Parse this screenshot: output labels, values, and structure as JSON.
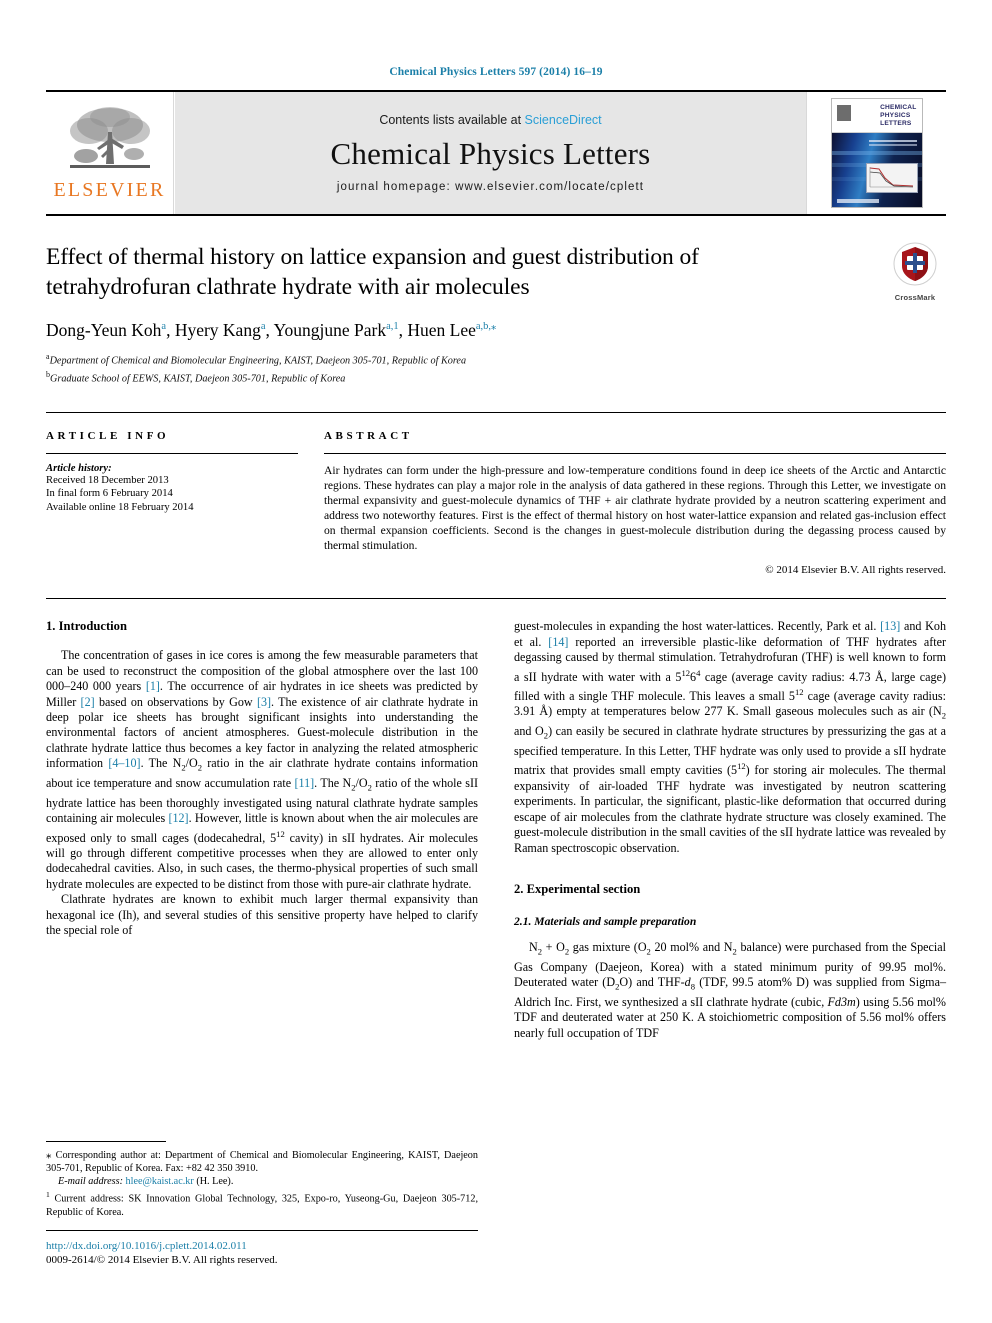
{
  "running_head": "Chemical Physics Letters 597 (2014) 16–19",
  "masthead": {
    "publisher_name": "ELSEVIER",
    "contents_prefix": "Contents lists available at ",
    "sciencedirect": "ScienceDirect",
    "journal_name": "Chemical Physics Letters",
    "homepage": "journal homepage: www.elsevier.com/locate/cplett",
    "cover_title_line1": "CHEMICAL",
    "cover_title_line2": "PHYSICS",
    "cover_title_line3": "LETTERS"
  },
  "article": {
    "title": "Effect of thermal history on lattice expansion and guest distribution of tetrahydrofuran clathrate hydrate with air molecules",
    "crossmark_label": "CrossMark",
    "authors": [
      {
        "name": "Dong-Yeun Koh",
        "marks": "a",
        "sep": ", "
      },
      {
        "name": "Hyery Kang",
        "marks": "a",
        "sep": ", "
      },
      {
        "name": "Youngjune Park",
        "marks": "a,1",
        "sep": ", "
      },
      {
        "name": "Huen Lee",
        "marks": "a,b,⁎",
        "sep": ""
      }
    ],
    "affiliations": [
      {
        "mark": "a",
        "text": "Department of Chemical and Biomolecular Engineering, KAIST, Daejeon 305-701, Republic of Korea"
      },
      {
        "mark": "b",
        "text": "Graduate School of EEWS, KAIST, Daejeon 305-701, Republic of Korea"
      }
    ]
  },
  "info": {
    "heading": "ARTICLE INFO",
    "history_label": "Article history:",
    "history": [
      "Received 18 December 2013",
      "In final form 6 February 2014",
      "Available online 18 February 2014"
    ]
  },
  "abstract": {
    "heading": "ABSTRACT",
    "text": "Air hydrates can form under the high-pressure and low-temperature conditions found in deep ice sheets of the Arctic and Antarctic regions. These hydrates can play a major role in the analysis of data gathered in these regions. Through this Letter, we investigate on thermal expansivity and guest-molecule dynamics of THF + air clathrate hydrate provided by a neutron scattering experiment and address two noteworthy features. First is the effect of thermal history on host water-lattice expansion and related gas-inclusion effect on thermal expansion coefficients. Second is the changes in guest-molecule distribution during the degassing process caused by thermal stimulation.",
    "copyright": "© 2014 Elsevier B.V. All rights reserved."
  },
  "sections": {
    "introduction_heading": "1. Introduction",
    "experimental_heading": "2. Experimental section",
    "materials_heading": "2.1. Materials and sample preparation"
  },
  "left_column": {
    "p1_a": "The concentration of gases in ice cores is among the few measurable parameters that can be used to reconstruct the composition of the global atmosphere over the last 100 000–240 000 years ",
    "p1_r1": "[1]",
    "p1_b": ". The occurrence of air hydrates in ice sheets was predicted by Miller ",
    "p1_r2": "[2]",
    "p1_c": " based on observations by Gow ",
    "p1_r3": "[3]",
    "p1_d": ". The existence of air clathrate hydrate in deep polar ice sheets has brought significant insights into understanding the environmental factors of ancient atmospheres. Guest-molecule distribution in the clathrate hydrate lattice thus becomes a key factor in analyzing the related atmospheric information ",
    "p1_r4": "[4–10]",
    "p1_e": ". The N",
    "p1_f": " ratio in the air clathrate hydrate contains information about ice temperature and snow accumulation rate ",
    "p1_r5": "[11]",
    "p1_g": ". The N",
    "p1_h": " ratio of the whole sII hydrate lattice has been thoroughly investigated using natural clathrate hydrate samples containing air molecules ",
    "p1_r6": "[12]",
    "p1_i": ". However, little is known about when the air molecules are exposed only to small cages (dodecahedral, 5",
    "p1_j": " cavity) in sII hydrates. Air molecules will go through different competitive processes when they are allowed to enter only dodecahedral cavities. Also, in such cases, the thermo-physical properties of such small hydrate molecules are expected to be distinct from those with pure-air clathrate hydrate.",
    "p2": "Clathrate hydrates are known to exhibit much larger thermal expansivity than hexagonal ice (Ih), and several studies of this sensitive property have helped to clarify the special role of"
  },
  "right_column": {
    "p1_a": "guest-molecules in expanding the host water-lattices. Recently, Park et al. ",
    "p1_r1": "[13]",
    "p1_b": " and Koh et al. ",
    "p1_r2": "[14]",
    "p1_c": " reported an irreversible plastic-like deformation of THF hydrates after degassing caused by thermal stimulation. Tetrahydrofuran (THF) is well known to form a sII hydrate with water with a 5",
    "p1_d": " cage (average cavity radius: 4.73 Å, large cage) filled with a single THF molecule. This leaves a small 5",
    "p1_e": " cage (average cavity radius: 3.91 Å) empty at temperatures below 277 K. Small gaseous molecules such as air (N",
    "p1_f": " and O",
    "p1_g": ") can easily be secured in clathrate hydrate structures by pressurizing the gas at a specified temperature. In this Letter, THF hydrate was only used to provide a sII hydrate matrix that provides small empty cavities (5",
    "p1_h": ") for storing air molecules. The thermal expansivity of air-loaded THF hydrate was investigated by neutron scattering experiments. In particular, the significant, plastic-like deformation that occurred during escape of air molecules from the clathrate hydrate structure was closely examined. The guest-molecule distribution in the small cavities of the sII hydrate lattice was revealed by Raman spectroscopic observation.",
    "p2_a": "N",
    "p2_b": " + O",
    "p2_c": " gas mixture (O",
    "p2_d": " 20 mol% and N",
    "p2_e": " balance) were purchased from the Special Gas Company (Daejeon, Korea) with a stated minimum purity of 99.95 mol%. Deuterated water (D",
    "p2_f": "O) and THF-",
    "p2_g": "d",
    "p2_h": "8",
    "p2_i": " (TDF, 99.5 atom% D) was supplied from Sigma–Aldrich Inc. First, we synthesized a sII clathrate hydrate (cubic, ",
    "p2_j": "Fd3m",
    "p2_k": ") using 5.56 mol% TDF and deuterated water at 250 K. A stoichiometric composition of 5.56 mol% offers nearly full occupation of TDF"
  },
  "footnotes": {
    "corresponding_mark": "⁎",
    "corresponding": " Corresponding author at: Department of Chemical and Biomolecular Engineering, KAIST, Daejeon 305-701, Republic of Korea. Fax: +82 42 350 3910.",
    "email_label": "E-mail address:",
    "email": "hlee@kaist.ac.kr",
    "email_suffix": " (H. Lee).",
    "current_mark": "1",
    "current_address": " Current address: SK Innovation Global Technology, 325, Expo-ro, Yuseong-Gu, Daejeon 305-712, Republic of Korea."
  },
  "bottom": {
    "doi": "http://dx.doi.org/10.1016/j.cplett.2014.02.011",
    "issn": "0009-2614/© 2014 Elsevier B.V. All rights reserved."
  },
  "colors": {
    "link": "#1b7fa8",
    "sciencedirect": "#2a9fd6",
    "elsevier_orange": "#E87722",
    "banner_bg": "#e6e6e6"
  }
}
